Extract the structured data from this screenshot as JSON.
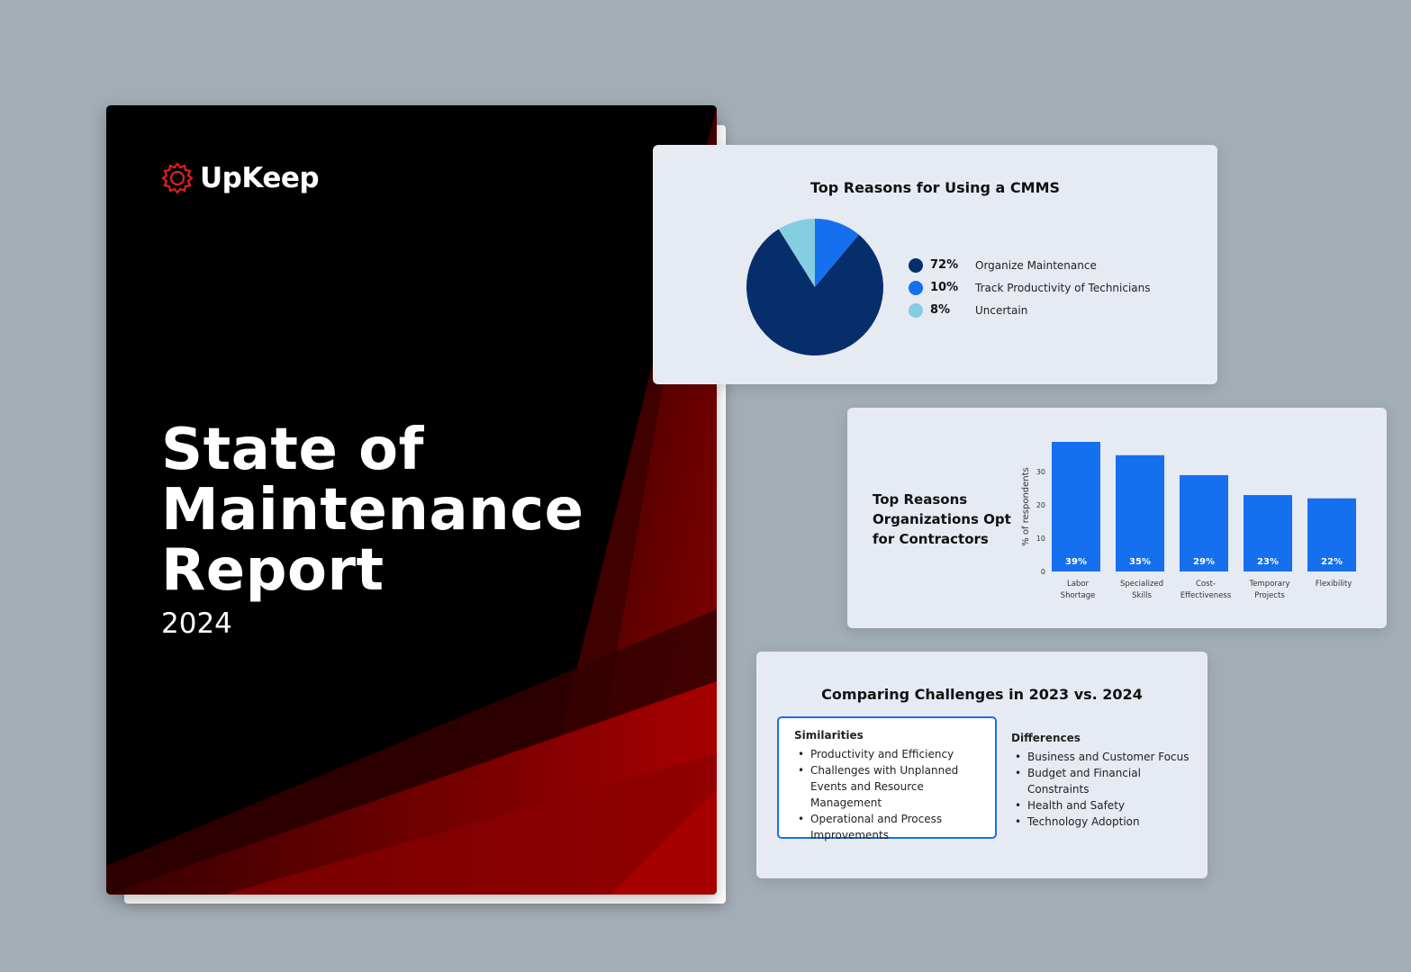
{
  "cover": {
    "brand": "UpKeep",
    "title_lines": [
      "State of",
      "Maintenance",
      "Report"
    ],
    "year": "2024",
    "colors": {
      "background": "#000000",
      "accent": "#b00000",
      "logo_icon": "#e0201b"
    }
  },
  "pie_card": {
    "title": "Top Reasons for Using a CMMS",
    "legend": [
      {
        "pct": "72%",
        "label": "Organize Maintenance",
        "color": "#062e6b"
      },
      {
        "pct": "10%",
        "label": "Track Productivity of Technicians",
        "color": "#1570ef"
      },
      {
        "pct": "8%",
        "label": "Uncertain",
        "color": "#85cde0"
      }
    ]
  },
  "bar_card": {
    "title_lines": [
      "Top Reasons",
      "Organizations Opt",
      "for Contractors"
    ]
  },
  "compare_card": {
    "title": "Comparing Challenges in 2023 vs. 2024",
    "similarities": {
      "heading": "Similarities",
      "items": [
        "Productivity and Efficiency",
        "Challenges with Unplanned Events and Resource Management",
        "Operational and Process Improvements"
      ]
    },
    "differences": {
      "heading": "Differences",
      "items": [
        "Business and Customer Focus",
        "Budget and Financial Constraints",
        "Health and Safety",
        "Technology Adoption"
      ]
    }
  },
  "chart_data": [
    {
      "type": "pie",
      "title": "Top Reasons for Using a CMMS",
      "categories": [
        "Organize Maintenance",
        "Track Productivity of Technicians",
        "Uncertain"
      ],
      "values": [
        72,
        10,
        8
      ],
      "colors": [
        "#062e6b",
        "#1570ef",
        "#85cde0"
      ],
      "legend_placement": "right"
    },
    {
      "type": "bar",
      "title": "Top Reasons Organizations Opt for Contractors",
      "categories": [
        [
          "Labor",
          "Shortage"
        ],
        [
          "Specialized",
          "Skills"
        ],
        [
          "Cost-",
          "Effectiveness"
        ],
        [
          "Temporary",
          "Projects"
        ],
        [
          "Flexibility"
        ]
      ],
      "values": [
        39,
        35,
        29,
        23,
        22
      ],
      "data_labels": [
        "39%",
        "35%",
        "29%",
        "23%",
        "22%"
      ],
      "ylabel": "% of respondents",
      "yticks": [
        0,
        10,
        20,
        30
      ],
      "ylim": [
        0,
        39
      ],
      "bar_color": "#1570ef",
      "grid": false
    }
  ]
}
